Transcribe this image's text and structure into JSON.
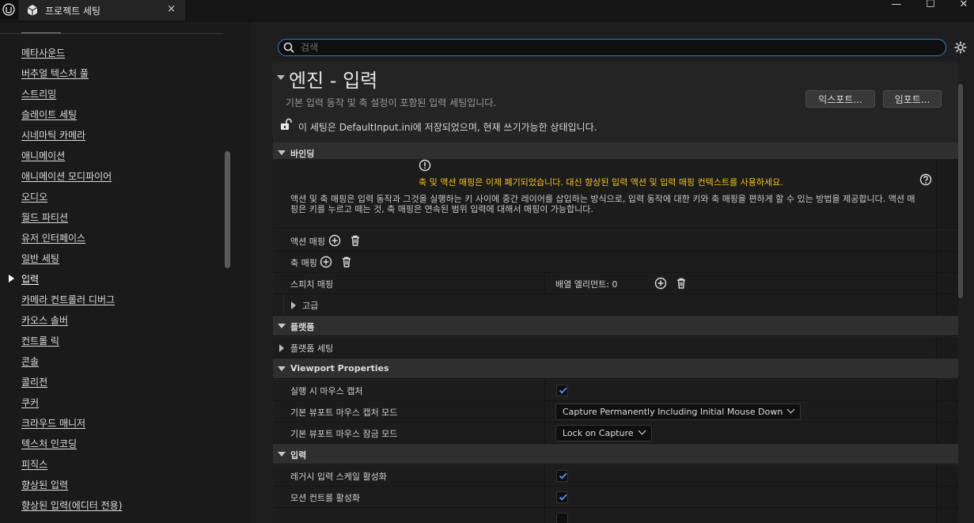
{
  "window": {
    "tab_title": "프로젝트 세팅",
    "close_glyph": "×",
    "minimize_glyph": "—",
    "maximize_glyph": "☐",
    "close_window_glyph": "✕"
  },
  "sidebar": {
    "items": [
      "메타사운드",
      "버추얼 텍스처 풀",
      "스트리밍",
      "슬레이트 세팅",
      "시네마틱 카메라",
      "애니메이션",
      "애니메이션 모디파이어",
      "오디오",
      "월드 파티션",
      "유저 인터페이스",
      "일반 세팅",
      "입력",
      "카메라 컨트롤러 디버그",
      "카오스 솔버",
      "컨트롤 릭",
      "콘솔",
      "콜리전",
      "쿠커",
      "크라우드 매니저",
      "텍스처 인코딩",
      "피직스",
      "향상된 입력",
      "향상된 입력(에디터 전용)"
    ],
    "active_index": 11
  },
  "search": {
    "placeholder": "검색"
  },
  "header": {
    "title": "엔진 - 입력",
    "description": "기본 입력 동작 및 축 설정이 포함된 입력 세팅입니다.",
    "export_label": "익스포트...",
    "import_label": "임포트...",
    "lock_text": "이 세팅은 DefaultInput.ini에 저장되었으며, 현재 쓰기가능한 상태입니다."
  },
  "bindings": {
    "category": "바인딩",
    "warning": "축 및 액션 매핑은 이제 폐기되었습니다. 대신 향상된 입력 액션 및 입력 매핑 컨텍스트를 사용하세요.",
    "info": "액션 및 축 매핑은 입력 동작과 그것을 실행하는 키 사이에 중간 레이어를 삽입하는 방식으로, 입력 동작에 대한 키와 축 매핑을 편하게 할 수 있는 방법을 제공합니다. 액션 매핑은 키를 누르고 떼는 것, 축 매핑은 연속된 범위 입력에 대해서 매핑이 가능합니다.",
    "action_mappings": "액션 매핑",
    "axis_mappings": "축 매핑",
    "speech_mappings": "스피치 매핑",
    "array_elements": "배열 엘리먼트: 0",
    "advanced": "고급"
  },
  "platform": {
    "category": "플랫폼",
    "settings": "플랫폼 세팅"
  },
  "viewport": {
    "category": "Viewport Properties",
    "capture_on_launch": "실행 시 마우스 캡처",
    "capture_on_launch_checked": true,
    "capture_mode_label": "기본 뷰포트 마우스 캡처 모드",
    "capture_mode_value": "Capture Permanently Including Initial Mouse Down",
    "lock_mode_label": "기본 뷰포트 마우스 잠금 모드",
    "lock_mode_value": "Lock on Capture"
  },
  "input": {
    "category": "입력",
    "legacy_scale": "레거시 입력 스케일 활성화",
    "legacy_scale_checked": true,
    "motion_controls": "모션 컨트롤 활성화",
    "motion_controls_checked": true
  },
  "colors": {
    "accent": "#2e7ad6",
    "warning": "#f1c21b",
    "panel": "#242424"
  }
}
